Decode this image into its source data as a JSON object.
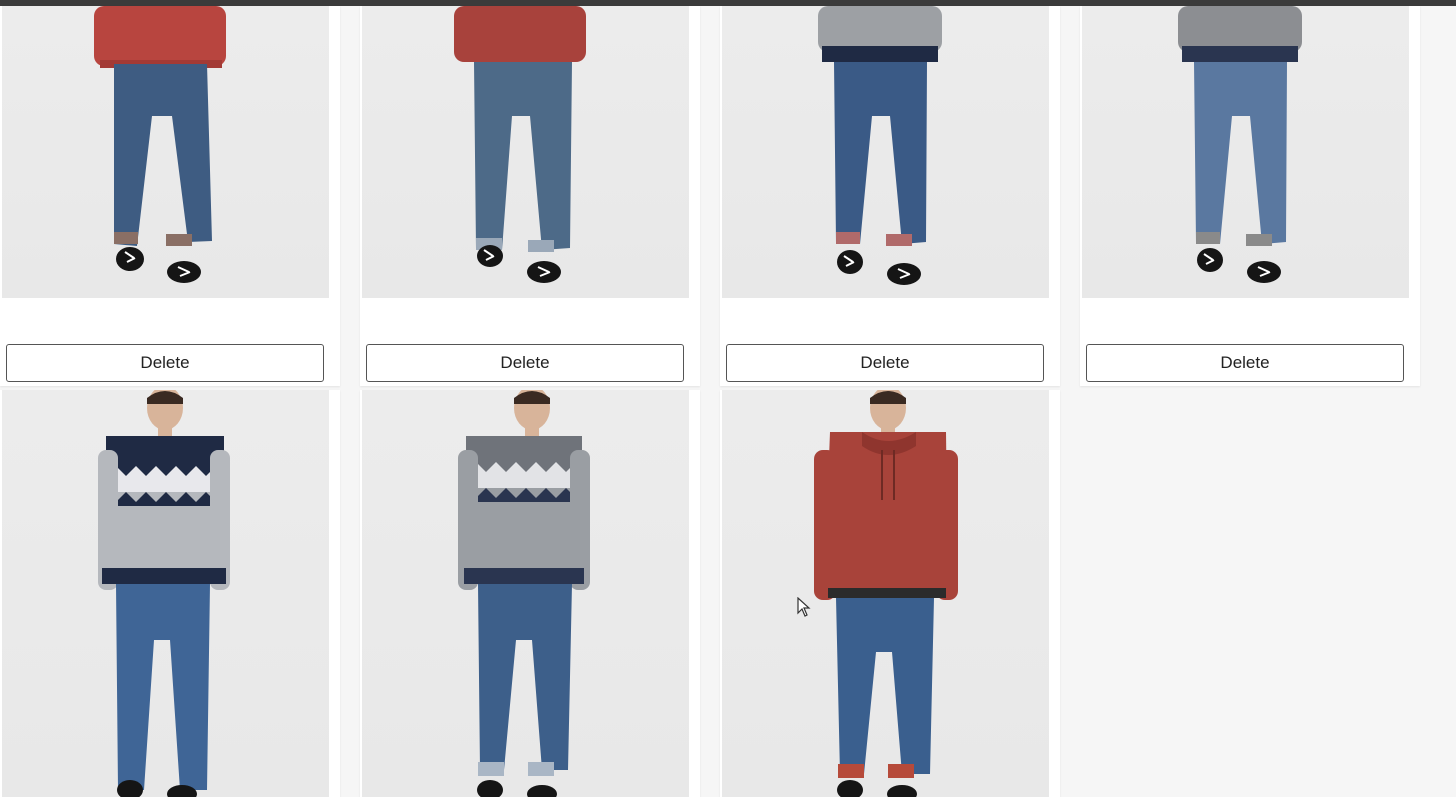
{
  "products": [
    {
      "delete_label": "Delete",
      "sweater": "red-sweater",
      "colors": {
        "top": "#b8453f",
        "jeans": "#3e5c82",
        "cuff": "#8a6f65"
      }
    },
    {
      "delete_label": "Delete",
      "sweater": "red-sweater",
      "colors": {
        "top": "#a8423c",
        "jeans": "#4d6a88",
        "cuff": "#8a6f65"
      }
    },
    {
      "delete_label": "Delete",
      "sweater": "grey-sweater",
      "colors": {
        "top": "#9da0a4",
        "jeans": "#3a5a86",
        "cuff": "#b06a6a"
      }
    },
    {
      "delete_label": "Delete",
      "sweater": "grey-sweater",
      "colors": {
        "top": "#8c8e92",
        "jeans": "#5a78a0",
        "cuff": "#8a8a8a"
      }
    },
    {
      "sweater": "navy-fairisle-sweater",
      "colors": {
        "top": "#b5b8bd",
        "band": "#1f2a44",
        "jeans": "#3f6596"
      }
    },
    {
      "sweater": "grey-fairisle-sweater",
      "colors": {
        "top": "#9a9ea3",
        "band": "#2a3550",
        "jeans": "#3d5f8a"
      }
    },
    {
      "sweater": "red-hoodie",
      "colors": {
        "top": "#a8433a",
        "jeans": "#3a5f8e"
      }
    }
  ]
}
